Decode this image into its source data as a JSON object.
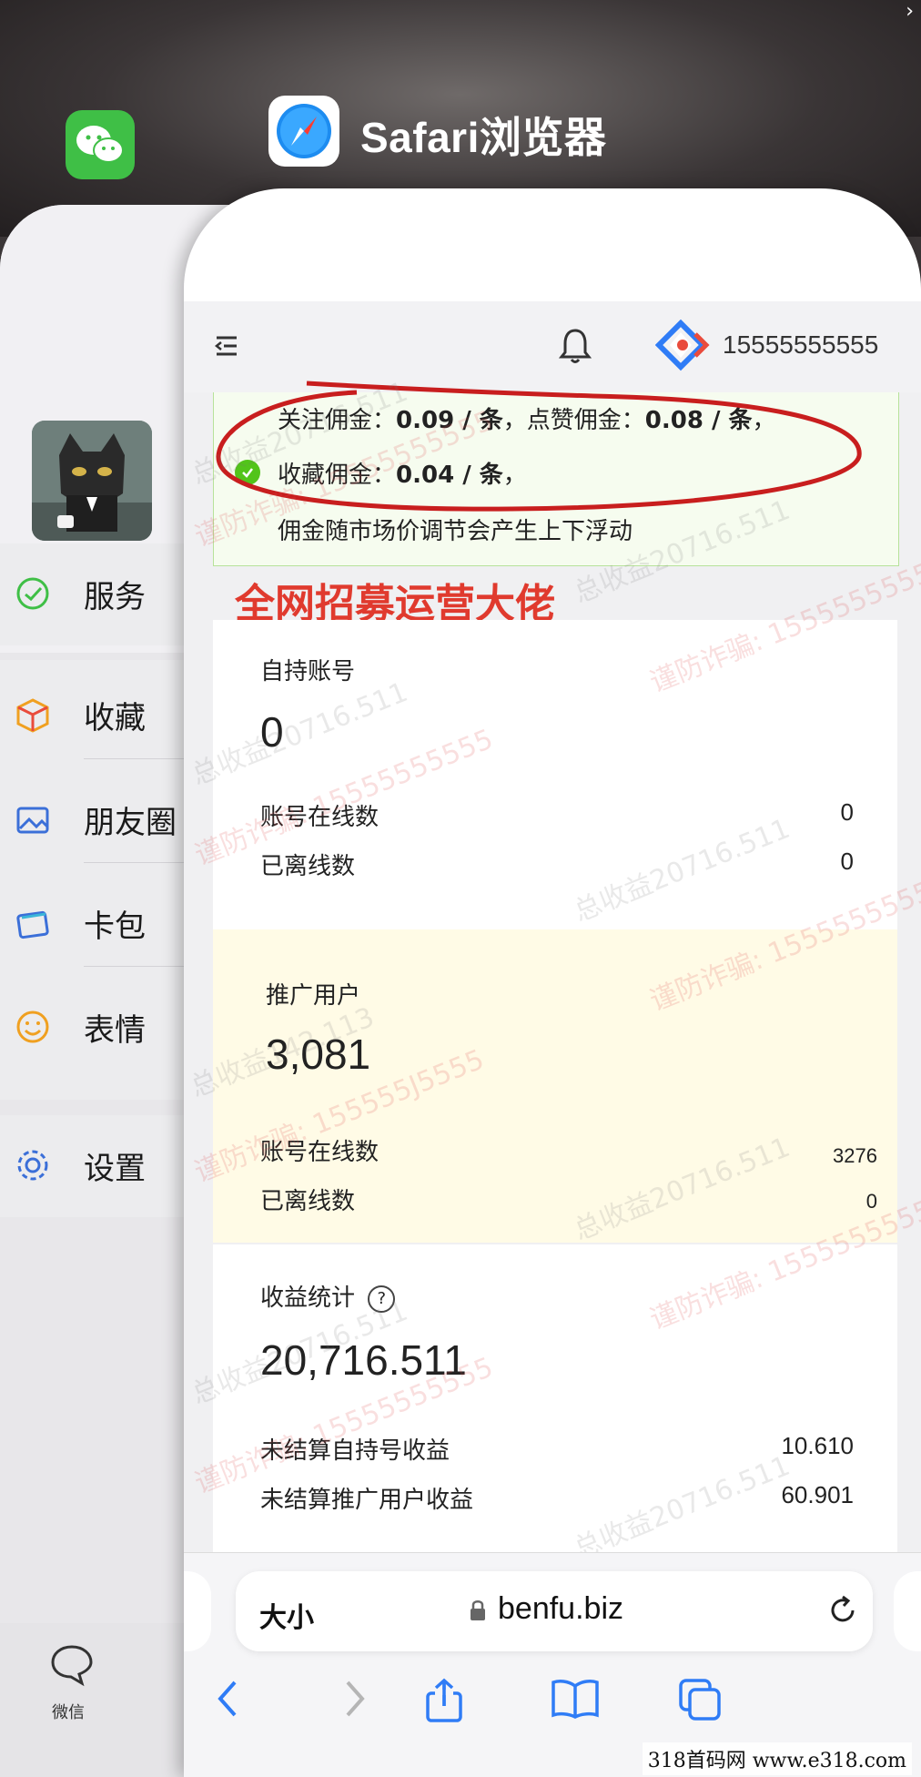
{
  "switcher": {
    "safari_title": "Safari浏览器"
  },
  "wechat": {
    "menu": [
      {
        "label": "服务",
        "icon": "service-icon"
      },
      {
        "label": "收藏",
        "icon": "favorites-icon"
      },
      {
        "label": "朋友圈",
        "icon": "moments-icon"
      },
      {
        "label": "卡包",
        "icon": "card-wallet-icon"
      },
      {
        "label": "表情",
        "icon": "emoji-icon"
      },
      {
        "label": "设置",
        "icon": "settings-icon"
      }
    ],
    "tab_label": "微信"
  },
  "site": {
    "phone": "15555555555",
    "notice": {
      "follow_label": "关注佣金：",
      "follow_value": "0.09 / 条",
      "sep1": "，",
      "like_label": "点赞佣金：",
      "like_value": "0.08 / 条",
      "sep2": "，",
      "collect_label": "收藏佣金：",
      "collect_value": "0.04 / 条",
      "sep3": "，",
      "float_note": "佣金随市场价调节会产生上下浮动"
    },
    "headline": "全网招募运营大佬",
    "own_accounts": {
      "title": "自持账号",
      "count": "0",
      "online_label": "账号在线数",
      "online_value": "0",
      "offline_label": "已离线数",
      "offline_value": "0"
    },
    "promo_users": {
      "title": "推广用户",
      "count": "3,081",
      "online_label": "账号在线数",
      "online_value": "3276",
      "offline_label": "已离线数",
      "offline_value": "0"
    },
    "earnings": {
      "title": "收益统计",
      "help_glyph": "?",
      "total": "20,716.511",
      "unsettled_own_label": "未结算自持号收益",
      "unsettled_own_value": "10.610",
      "unsettled_promo_label": "未结算推广用户收益",
      "unsettled_promo_value": "60.901"
    },
    "watermarks": {
      "income": "总收益20716.511",
      "income_alt": "总收益142.113",
      "fraud": "谨防诈骗: 15555555555",
      "fraud_alt": "谨防诈骗: 155555J5555"
    }
  },
  "browser": {
    "text_size_label": "大小",
    "url": "benfu.biz"
  },
  "source_watermark": "318首码网  www.e318.com",
  "colors": {
    "accent_red": "#e03a2e",
    "success_green": "#52c41a",
    "ios_blue": "#2f7cf6",
    "wechat_green": "#3fbf46"
  }
}
